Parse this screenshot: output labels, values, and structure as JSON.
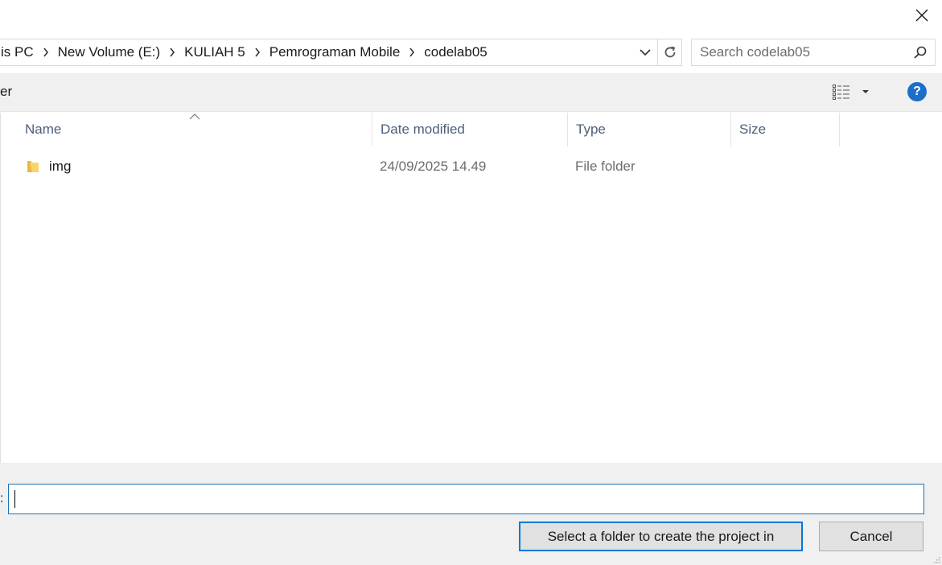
{
  "dialog": {
    "close_icon": "close-icon"
  },
  "address_bar": {
    "crumbs": [
      "is PC",
      "New Volume (E:)",
      "KULIAH 5",
      "Pemrograman Mobile",
      "codelab05"
    ],
    "dropdown_icon": "chevron-down-icon",
    "refresh_icon": "refresh-icon"
  },
  "search": {
    "placeholder": "Search codelab05",
    "icon": "search-icon"
  },
  "command_bar": {
    "new_folder_label": "er",
    "view_icon": "details-view-icon",
    "help_label": "?"
  },
  "file_list": {
    "columns": [
      "Name",
      "Date modified",
      "Type",
      "Size"
    ],
    "sort_icon": "sort-ascending-caret-icon",
    "rows": [
      {
        "name": "img",
        "date_modified": "24/09/2025 14.49",
        "type": "File folder",
        "size": ""
      }
    ]
  },
  "footer": {
    "filename_label": ":",
    "filename_value": "",
    "select_button_label": "Select a folder to create the project in",
    "cancel_button_label": "Cancel"
  },
  "colors": {
    "accent": "#0078d7",
    "header_text": "#4c607a",
    "help_blue": "#1c6fc8",
    "panel_bg": "#f0f0f0"
  }
}
